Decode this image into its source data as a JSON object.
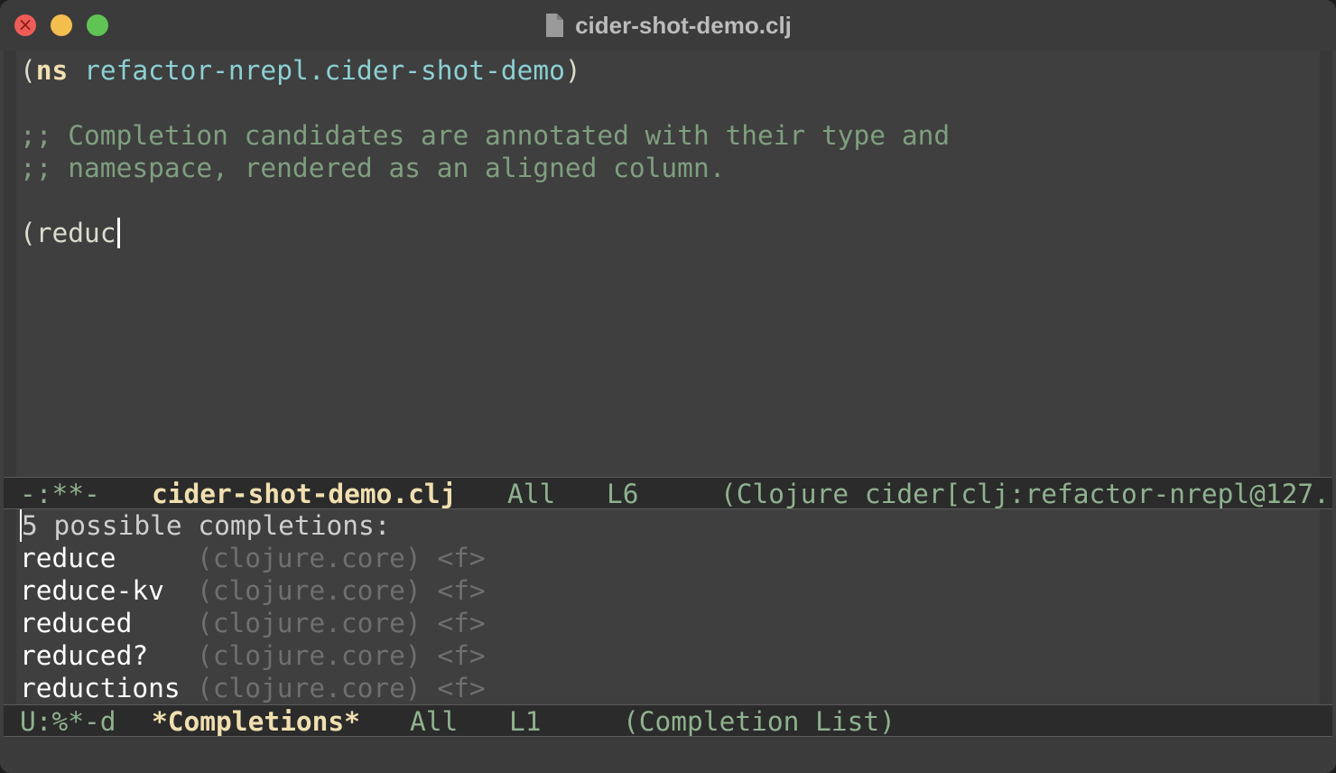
{
  "window": {
    "title": "cider-shot-demo.clj"
  },
  "editor": {
    "lines": [
      {
        "paren": "(",
        "keyword": "ns",
        "namespace": "refactor-nrepl.cider-shot-demo",
        "close": ")"
      },
      {
        "comment": ";; Completion candidates are annotated with their type and"
      },
      {
        "comment": ";; namespace, rendered as an aligned column."
      },
      {
        "code": "(reduc"
      }
    ]
  },
  "modeline_main": {
    "status": "-:**-",
    "buffer": "cider-shot-demo.clj",
    "position": "All",
    "line": "L6",
    "mode": "(Clojure cider[clj:refactor-nrepl@127."
  },
  "completions": {
    "header_first_char": "5",
    "header_rest": " possible completions:",
    "items": [
      {
        "name": "reduce",
        "annotation": "(clojure.core) <f>"
      },
      {
        "name": "reduce-kv",
        "annotation": "(clojure.core) <f>"
      },
      {
        "name": "reduced",
        "annotation": "(clojure.core) <f>"
      },
      {
        "name": "reduced?",
        "annotation": "(clojure.core) <f>"
      },
      {
        "name": "reductions",
        "annotation": "(clojure.core) <f>"
      }
    ]
  },
  "modeline_completions": {
    "status": "U:%*-d",
    "buffer": "*Completions*",
    "position": "All",
    "line": "L1",
    "mode": "(Completion List)"
  },
  "colors": {
    "background": "#3f3f3f",
    "keyword": "#f0dfaf",
    "namespace": "#8cd0d3",
    "comment": "#7f9f7f",
    "annotation": "#6f6f6f",
    "modeline_bg": "#2b2b2b"
  }
}
